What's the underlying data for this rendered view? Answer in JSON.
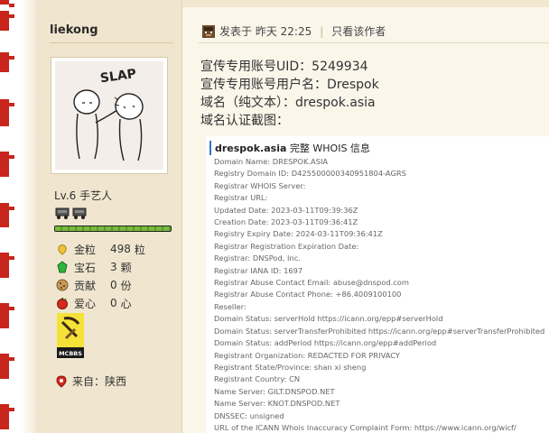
{
  "user": {
    "username": "liekong",
    "level": "Lv.6 手艺人",
    "stats": [
      {
        "icon": "gold-nugget-icon",
        "label": "金粒",
        "value": "498",
        "unit": "粒"
      },
      {
        "icon": "emerald-icon",
        "label": "宝石",
        "value": "3",
        "unit": "颗"
      },
      {
        "icon": "cookie-icon",
        "label": "贡献",
        "value": "0",
        "unit": "份"
      },
      {
        "icon": "apple-icon",
        "label": "爱心",
        "value": "0",
        "unit": "心"
      }
    ],
    "badge_text": "MCBBS",
    "from": "来自：陕西",
    "level_progress": 1.0
  },
  "post": {
    "posted_at": "发表于 昨天 22:25",
    "separator": "|",
    "author_only": "只看该作者",
    "lines": [
      "宣传专用账号UID：5249934",
      "宣传专用账号用户名：Drespok",
      "域名（纯文本）：drespok.asia",
      "域名认证截图："
    ]
  },
  "whois": {
    "domain": "drespok.asia",
    "title_suffix": " 完整 WHOIS 信息",
    "lines": [
      "Domain Name: DRESPOK.ASIA",
      "Registry Domain ID: D425500000340951804-AGRS",
      "Registrar WHOIS Server:",
      "Registrar URL:",
      "Updated Date: 2023-03-11T09:39:36Z",
      "Creation Date: 2023-03-11T09:36:41Z",
      "Registry Expiry Date: 2024-03-11T09:36:41Z",
      "Registrar Registration Expiration Date:",
      "Registrar: DNSPod, Inc.",
      "Registrar IANA ID: 1697",
      "Registrar Abuse Contact Email: abuse@dnspod.com",
      "Registrar Abuse Contact Phone: +86.4009100100",
      "Reseller:",
      "Domain Status: serverHold https://icann.org/epp#serverHold",
      "Domain Status: serverTransferProhibited https://icann.org/epp#serverTransferProhibited",
      "Domain Status: addPeriod https://icann.org/epp#addPeriod",
      "Registrant Organization: REDACTED FOR PRIVACY",
      "Registrant State/Province: shan xi sheng",
      "Registrant Country: CN",
      "Name Server: GILT.DNSPOD.NET",
      "Name Server: KNOT.DNSPOD.NET",
      "DNSSEC: unsigned",
      "URL of the ICANN Whois Inaccuracy Complaint Form: https://www.icann.org/wicf/"
    ]
  },
  "colors": {
    "accent_red": "#c8251c",
    "link_blue": "#2f78c4",
    "panel_bg": "#f0e6cf"
  }
}
